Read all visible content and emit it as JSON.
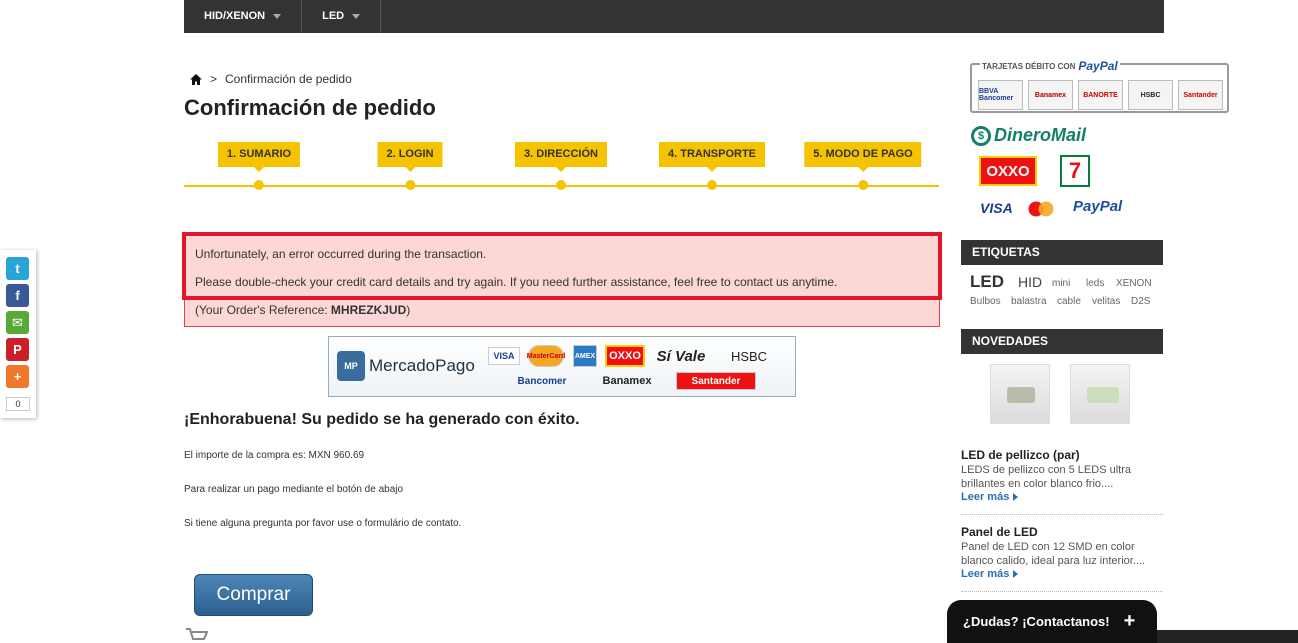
{
  "nav": {
    "items": [
      {
        "label": "HID/XENON"
      },
      {
        "label": "LED"
      }
    ]
  },
  "breadcrumb": {
    "separator": ">",
    "current": "Confirmación de pedido"
  },
  "page": {
    "title": "Confirmación de pedido"
  },
  "steps": [
    {
      "label": "1. SUMARIO"
    },
    {
      "label": "2. LOGIN"
    },
    {
      "label": "3. DIRECCIÓN"
    },
    {
      "label": "4. TRANSPORTE"
    },
    {
      "label": "5. MODO DE PAGO"
    }
  ],
  "error": {
    "line1": "Unfortunately, an error occurred during the transaction.",
    "line2": "Please double-check your credit card details and try again. If you need further assistance, feel free to contact us anytime.",
    "ref_prefix": "(Your Order's Reference: ",
    "ref_code": "MHREZKJUD",
    "ref_suffix": ")"
  },
  "mercadopago": {
    "badge": "MP",
    "name": "MercadoPago",
    "brands": [
      "VISA",
      "MasterCard",
      "AMEX",
      "OXXO",
      "Sí Vale",
      "HSBC",
      "Bancomer",
      "Banamex",
      "Santander"
    ]
  },
  "success": {
    "heading": "¡Enhorabuena! Su pedido se ha generado con éxito.",
    "amount_text": "El importe de la compra es: MXN 960.69",
    "pay_text": "Para realizar un pago mediante el botón de abajo",
    "contact_text": "Si tiene alguna pregunta por favor use o formulário de contato."
  },
  "buy_button": {
    "label": "Comprar"
  },
  "share": {
    "count": "0"
  },
  "sidebar": {
    "paypal_box": {
      "title": "TARJETAS DÉBITO CON",
      "brand": "PayPal",
      "banks": [
        "BBVA Bancomer",
        "Banamex",
        "BANORTE",
        "HSBC",
        "Santander"
      ]
    },
    "payment_logos": {
      "dineromail": "DineroMail",
      "oxxo": "OXXO",
      "seven": "7",
      "visa": "VISA",
      "paypal": "PayPal"
    },
    "tags_heading": "ETIQUETAS",
    "tags": [
      "LED",
      "HID",
      "mini",
      "leds",
      "XENON",
      "Bulbos",
      "balastra",
      "cable",
      "velitas",
      "D2S"
    ],
    "news_heading": "NOVEDADES",
    "products": [
      {
        "title": "LED de pellizco (par)",
        "desc": "LEDS de pellizco con 5 LEDS ultra brillantes en color blanco frio....",
        "more": "Leer más"
      },
      {
        "title": "Panel de LED",
        "desc": "Panel de LED con 12 SMD en color blanco calido, ideal para luz interior....",
        "more": "Leer más"
      }
    ]
  },
  "contact_tab": {
    "label": "¿Dudas? ¡Contactanos!",
    "plus": "+"
  }
}
